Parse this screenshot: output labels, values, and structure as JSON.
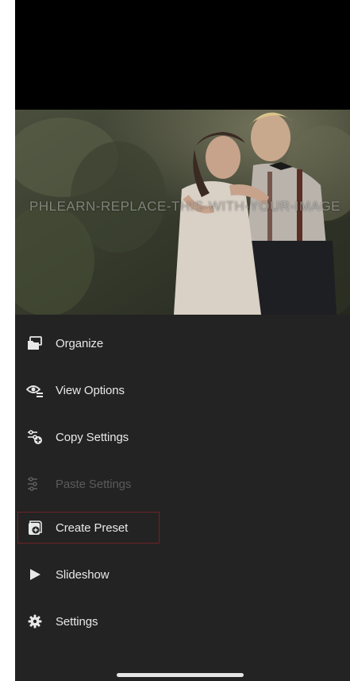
{
  "photo": {
    "watermark_text": "PHLEARN-REPLACE-THIS-WITH-YOUR-IMAGE"
  },
  "menu": {
    "items": [
      {
        "label": "Organize",
        "icon": "folder-stack-icon",
        "enabled": true
      },
      {
        "label": "View Options",
        "icon": "view-options-icon",
        "enabled": true
      },
      {
        "label": "Copy Settings",
        "icon": "copy-settings-icon",
        "enabled": true
      },
      {
        "label": "Paste Settings",
        "icon": "paste-settings-icon",
        "enabled": false
      },
      {
        "label": "Create Preset",
        "icon": "create-preset-icon",
        "enabled": true,
        "highlighted": true
      },
      {
        "label": "Slideshow",
        "icon": "play-icon",
        "enabled": true
      },
      {
        "label": "Settings",
        "icon": "gear-icon",
        "enabled": true
      }
    ]
  },
  "colors": {
    "menu_background": "#232323",
    "label_text": "#e8e8e8",
    "disabled_text": "#5b5b5b",
    "highlight_border": "#6b2328"
  }
}
